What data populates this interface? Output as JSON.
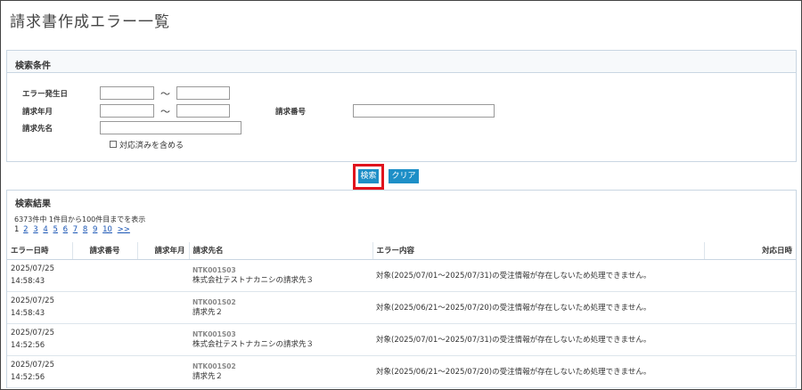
{
  "page": {
    "title": "請求書作成エラー一覧"
  },
  "conditions": {
    "heading": "検索条件",
    "error_date_label": "エラー発生日",
    "billing_month_label": "請求年月",
    "billing_number_label": "請求番号",
    "billing_target_label": "請求先名",
    "tilde": "〜",
    "include_done_label": "対応済みを含める"
  },
  "buttons": {
    "search": "検索",
    "clear": "クリア"
  },
  "results": {
    "heading": "検索結果",
    "count_text": "6373件中 1件目から100件目までを表示",
    "pager": {
      "current": "1",
      "pages": [
        "2",
        "3",
        "4",
        "5",
        "6",
        "7",
        "8",
        "9",
        "10"
      ],
      "next": ">>"
    },
    "columns": [
      "エラー日時",
      "請求番号",
      "請求年月",
      "請求先名",
      "エラー内容",
      "対応日時"
    ],
    "rows": [
      {
        "date": "2025/07/25",
        "time": "14:58:43",
        "number": "",
        "month": "",
        "code": "NTK001S03",
        "name": "株式会社テストナカニシの請求先３",
        "error": "対象(2025/07/01〜2025/07/31)の受注情報が存在しないため処理できません。",
        "handled": ""
      },
      {
        "date": "2025/07/25",
        "time": "14:58:43",
        "number": "",
        "month": "",
        "code": "NTK001S02",
        "name": "請求先２",
        "error": "対象(2025/06/21〜2025/07/20)の受注情報が存在しないため処理できません。",
        "handled": ""
      },
      {
        "date": "2025/07/25",
        "time": "14:52:56",
        "number": "",
        "month": "",
        "code": "NTK001S03",
        "name": "株式会社テストナカニシの請求先３",
        "error": "対象(2025/07/01〜2025/07/31)の受注情報が存在しないため処理できません。",
        "handled": ""
      },
      {
        "date": "2025/07/25",
        "time": "14:52:56",
        "number": "",
        "month": "",
        "code": "NTK001S02",
        "name": "請求先２",
        "error": "対象(2025/06/21〜2025/07/20)の受注情報が存在しないため処理できません。",
        "handled": ""
      }
    ]
  }
}
